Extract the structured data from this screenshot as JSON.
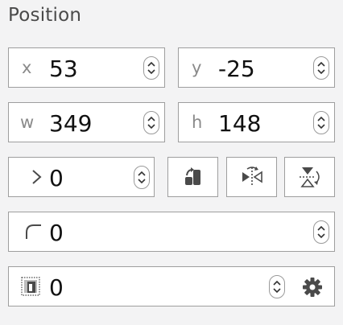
{
  "section": {
    "title": "Position"
  },
  "fields": {
    "x": {
      "label": "x",
      "value": "53"
    },
    "y": {
      "label": "y",
      "value": "-25"
    },
    "w": {
      "label": "w",
      "value": "349"
    },
    "h": {
      "label": "h",
      "value": "148"
    },
    "rotation": {
      "value": "0",
      "icon": "rotation-angle-icon"
    },
    "radius": {
      "value": "0",
      "icon": "corner-radius-icon"
    },
    "opacity": {
      "value": "0",
      "icon": "opacity-icon"
    }
  },
  "buttons": {
    "rotate": {
      "icon": "rotate-icon"
    },
    "flip_horizontal": {
      "icon": "flip-horizontal-icon"
    },
    "flip_vertical": {
      "icon": "flip-vertical-icon"
    },
    "settings": {
      "icon": "gear-icon"
    }
  },
  "colors": {
    "background": "#f3f3f4",
    "field_bg": "#ffffff",
    "border": "#9e9e9e",
    "label": "#8a8a8a",
    "icon": "#4a4a4a"
  }
}
